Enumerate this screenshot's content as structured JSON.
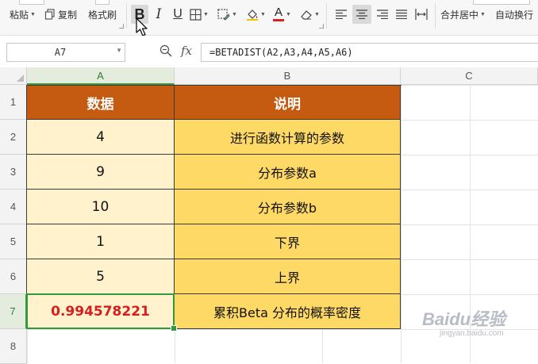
{
  "toolbar": {
    "paste_label": "粘贴",
    "copy_label": "复制",
    "format_painter_label": "格式刷",
    "merge_center_label": "合并居中",
    "auto_wrap_label": "自动换行"
  },
  "formula_bar": {
    "name_box": "A7",
    "fx_label": "fx",
    "formula": "=BETADIST(A2,A3,A4,A5,A6)"
  },
  "columns": [
    "A",
    "B",
    "C"
  ],
  "rows": [
    "1",
    "2",
    "3",
    "4",
    "5",
    "6",
    "7",
    "8"
  ],
  "table": {
    "headers": [
      "数据",
      "说明"
    ],
    "rows": [
      [
        "4",
        "进行函数计算的参数"
      ],
      [
        "9",
        "分布参数a"
      ],
      [
        "10",
        "分布参数b"
      ],
      [
        "1",
        "下界"
      ],
      [
        "5",
        "上界"
      ],
      [
        "0.994578221",
        "累积Beta 分布的概率密度"
      ]
    ]
  },
  "colors": {
    "header_fill": "#c55a11",
    "col_a_fill": "#fff2cc",
    "col_b_fill": "#ffd966",
    "result_text": "#d32020",
    "selection": "#2e9a3a"
  },
  "watermark": {
    "line1": "Baidu经验",
    "line2": "jingyan.baidu.com"
  }
}
